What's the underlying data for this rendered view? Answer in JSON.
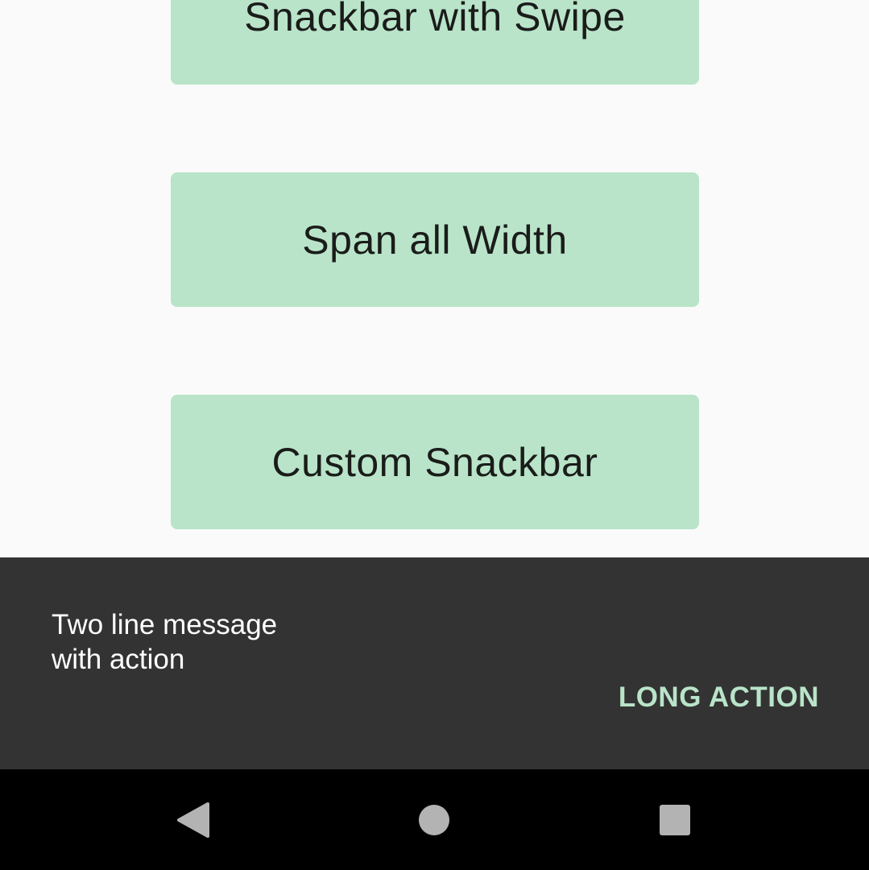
{
  "buttons": {
    "snackbar_with_swipe": "Snackbar with Swipe",
    "span_all_width": "Span all Width",
    "custom_snackbar": "Custom Snackbar"
  },
  "snackbar": {
    "message_line1": "Two line message",
    "message_line2": "with action",
    "action_label": "LONG ACTION"
  },
  "navbar": {
    "back_icon": "back-triangle-icon",
    "home_icon": "home-circle-icon",
    "recents_icon": "recents-square-icon"
  },
  "colors": {
    "button_bg": "#b9e4c9",
    "snackbar_bg": "#333333",
    "action_text": "#b9e4c9",
    "background": "#fafafa",
    "navbar_bg": "#000000"
  }
}
